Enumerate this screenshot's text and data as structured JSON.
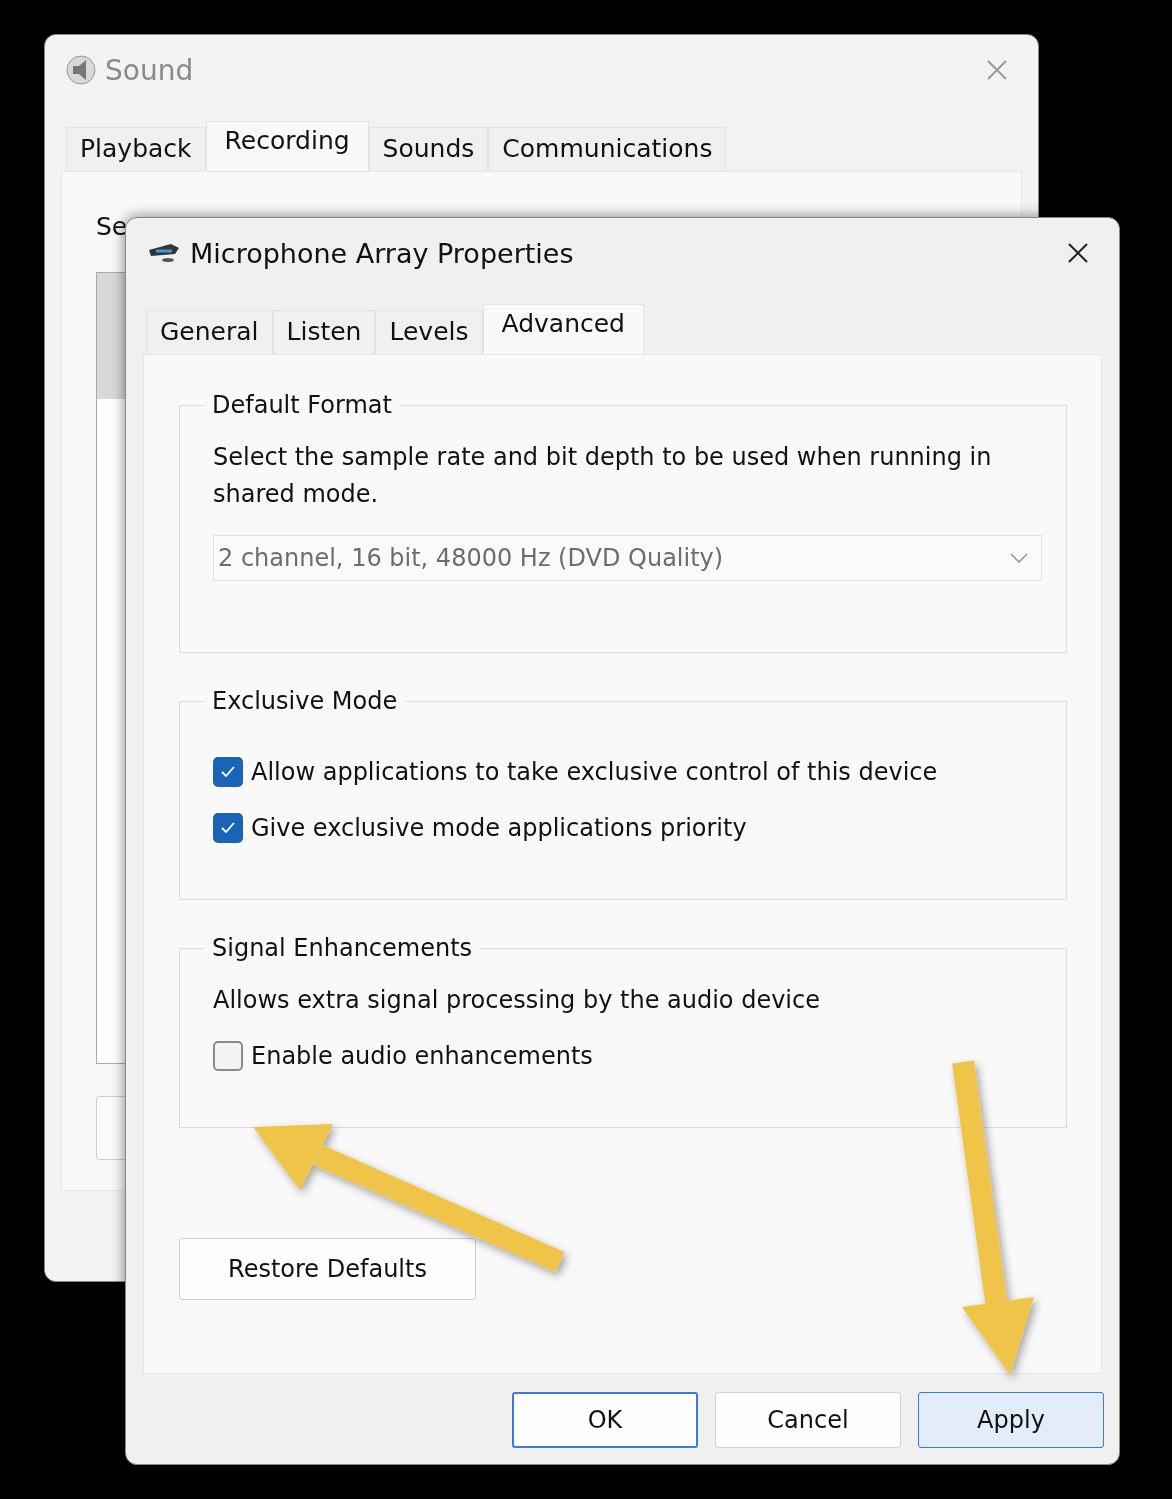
{
  "back_window": {
    "title": "Sound",
    "tabs": [
      {
        "label": "Playback",
        "selected": false
      },
      {
        "label": "Recording",
        "selected": true
      },
      {
        "label": "Sounds",
        "selected": false
      },
      {
        "label": "Communications",
        "selected": false
      }
    ],
    "instruction": "Se"
  },
  "dialog": {
    "title": "Microphone Array Properties",
    "tabs": [
      {
        "label": "General",
        "selected": false
      },
      {
        "label": "Listen",
        "selected": false
      },
      {
        "label": "Levels",
        "selected": false
      },
      {
        "label": "Advanced",
        "selected": true
      }
    ],
    "groups": [
      {
        "title": "Default Format",
        "description": "Select the sample rate and bit depth to be used when running in shared mode.",
        "dropdown": {
          "value": "2 channel, 16 bit, 48000 Hz (DVD Quality)",
          "disabled": true
        }
      },
      {
        "title": "Exclusive Mode",
        "options": [
          {
            "label": "Allow applications to take exclusive control of this device",
            "checked": true
          },
          {
            "label": "Give exclusive mode applications priority",
            "checked": true
          }
        ]
      },
      {
        "title": "Signal Enhancements",
        "description": "Allows extra signal processing by the audio device",
        "options": [
          {
            "label": "Enable audio enhancements",
            "checked": false
          }
        ]
      }
    ],
    "restore_button": "Restore Defaults",
    "buttons": [
      {
        "label": "OK",
        "is_default": true,
        "highlighted": false
      },
      {
        "label": "Cancel",
        "is_default": false,
        "highlighted": false
      },
      {
        "label": "Apply",
        "is_default": false,
        "highlighted": true
      }
    ]
  }
}
